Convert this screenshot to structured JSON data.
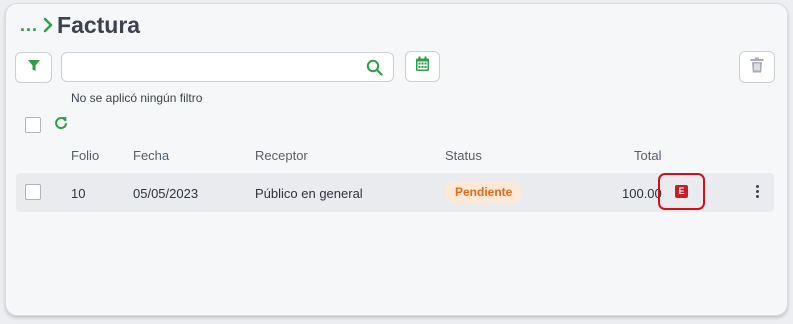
{
  "breadcrumb": {
    "ellipsis": "...",
    "title": "Factura"
  },
  "toolbar": {
    "search_value": "",
    "filter_status": "No se aplicó ningún filtro"
  },
  "table": {
    "columns": [
      "Folio",
      "Fecha",
      "Receptor",
      "Status",
      "Total"
    ],
    "rows": [
      {
        "folio": "10",
        "fecha": "05/05/2023",
        "receptor": "Público en general",
        "status": "Pendiente",
        "total": "100.00",
        "action_badge": "E"
      }
    ]
  },
  "colors": {
    "accent": "#2f9e48",
    "title": "#3b4350",
    "status_bg": "#fde9d6",
    "status_text": "#e36b1f",
    "highlight": "#d30f1b",
    "e_badge": "#cc1c24"
  },
  "icons": {
    "filter": "filter-icon",
    "search": "search-icon",
    "calendar": "calendar-icon",
    "trash": "trash-icon",
    "refresh": "refresh-icon",
    "more": "kebab-menu-icon"
  }
}
